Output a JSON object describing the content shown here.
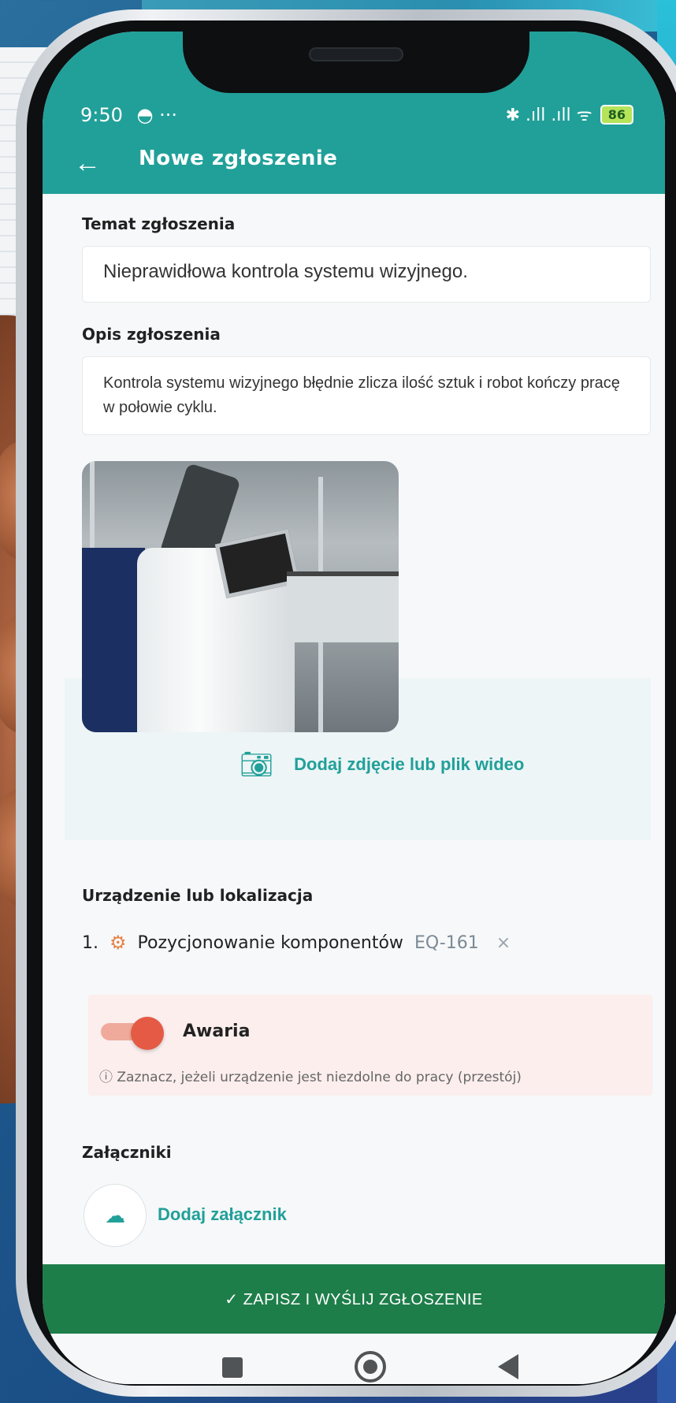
{
  "status_bar": {
    "time": "9:50",
    "left_icons": "◓ ···",
    "right_icons": "✱ .ıll .ıll ᯤ",
    "battery": "86"
  },
  "appbar": {
    "title": "Nowe zgłoszenie",
    "back_icon": "arrow-left-icon"
  },
  "form": {
    "subject_label": "Temat zgłoszenia",
    "subject_value": "Nieprawidłowa kontrola systemu wizyjnego.",
    "description_label": "Opis zgłoszenia",
    "description_value": "Kontrola systemu wizyjnego błędnie zlicza ilość sztuk i robot kończy pracę w połowie cyklu.",
    "add_media_label": "Dodaj zdjęcie lub plik wideo",
    "device_label": "Urządzenie lub lokalizacja",
    "device_item": {
      "index": "1.",
      "name": "Pozycjonowanie komponentów",
      "code": "EQ-161",
      "remove": "×"
    },
    "failure": {
      "label": "Awaria",
      "hint": "ⓘ Zaznacz, jeżeli urządzenie jest niezdolne do pracy (przestój)",
      "enabled": true
    },
    "attachments_label": "Załączniki",
    "add_attachment_label": "Dodaj załącznik"
  },
  "submit_label": "✓ ZAPISZ I WYŚLIJ ZGŁOSZENIE",
  "colors": {
    "primary": "#21a099",
    "submit": "#1e7e4a",
    "failure_bg": "#fbeeed",
    "toggle": "#e55a45"
  }
}
